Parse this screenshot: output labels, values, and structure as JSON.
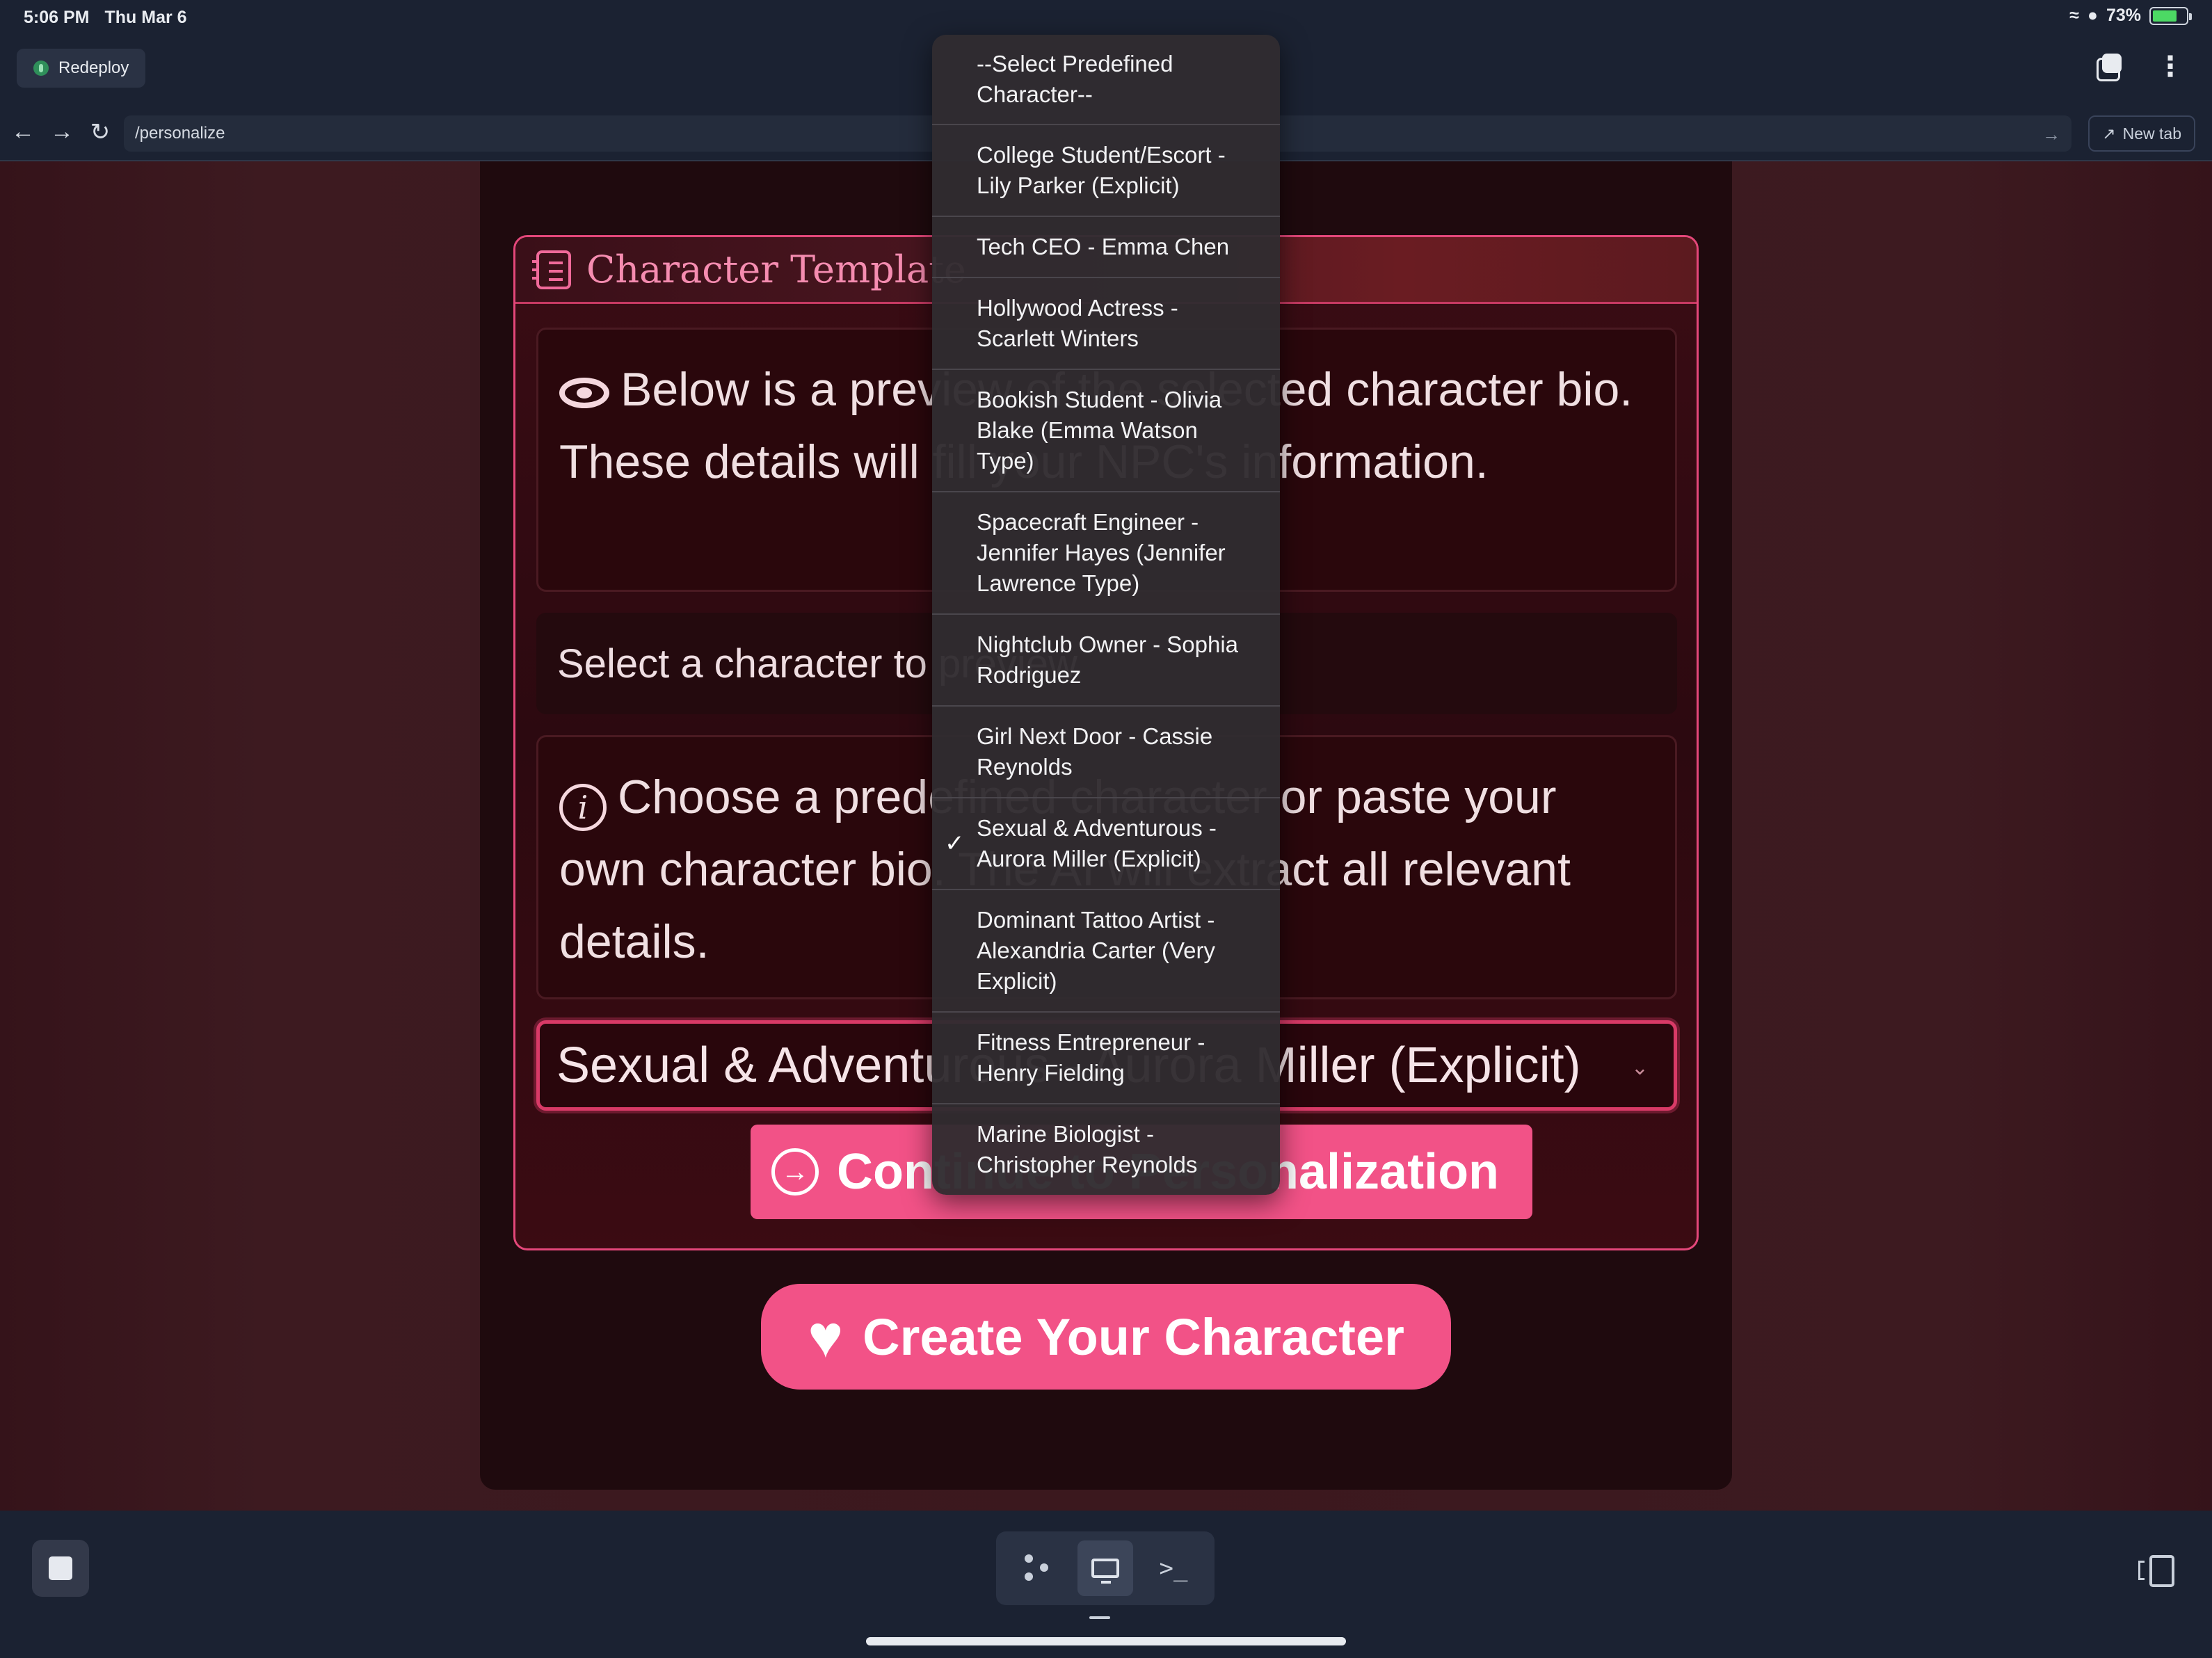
{
  "status_bar": {
    "time": "5:06 PM",
    "date": "Thu Mar 6",
    "battery": "73%",
    "battery_level": 0.73
  },
  "toolbar": {
    "redeploy_label": "Redeploy"
  },
  "urlbar": {
    "url": "/personalize",
    "new_tab_label": "New tab"
  },
  "card": {
    "title": "Character Template",
    "preview_text": "Below is a preview of the selected character bio. These details will fill your NPC's information.",
    "select_prompt": "Select a character to preview",
    "help_text": "Choose a predefined character or paste your own character bio. The AI will extract all relevant details.",
    "selected_value": "Sexual & Adventurous - Aurora Miller (Explicit)",
    "continue_label": "Continue to Personalization"
  },
  "create_button_label": "Create Your Character",
  "dropdown": {
    "options": [
      "--Select Predefined Character--",
      "College Student/Escort - Lily Parker (Explicit)",
      "Tech CEO - Emma Chen",
      "Hollywood Actress - Scarlett Winters",
      "Bookish Student - Olivia Blake (Emma Watson Type)",
      "Spacecraft Engineer - Jennifer Hayes (Jennifer Lawrence Type)",
      "Nightclub Owner - Sophia Rodriguez",
      "Girl Next Door - Cassie Reynolds",
      "Sexual & Adventurous - Aurora Miller (Explicit)",
      "Dominant Tattoo Artist - Alexandria Carter (Very Explicit)",
      "Fitness Entrepreneur - Henry Fielding",
      "Marine Biologist - Christopher Reynolds"
    ],
    "selected_index": 8
  },
  "colors": {
    "accent_pink": "#f25287",
    "card_border": "#e4477a",
    "background": "#1b2232"
  },
  "icons": {
    "back": "arrow-left-icon",
    "forward": "arrow-right-icon",
    "reload": "reload-icon",
    "eye": "eye-icon",
    "info": "info-icon",
    "heart": "heart-icon",
    "continue": "arrow-circle-icon",
    "check": "checkmark-icon"
  }
}
